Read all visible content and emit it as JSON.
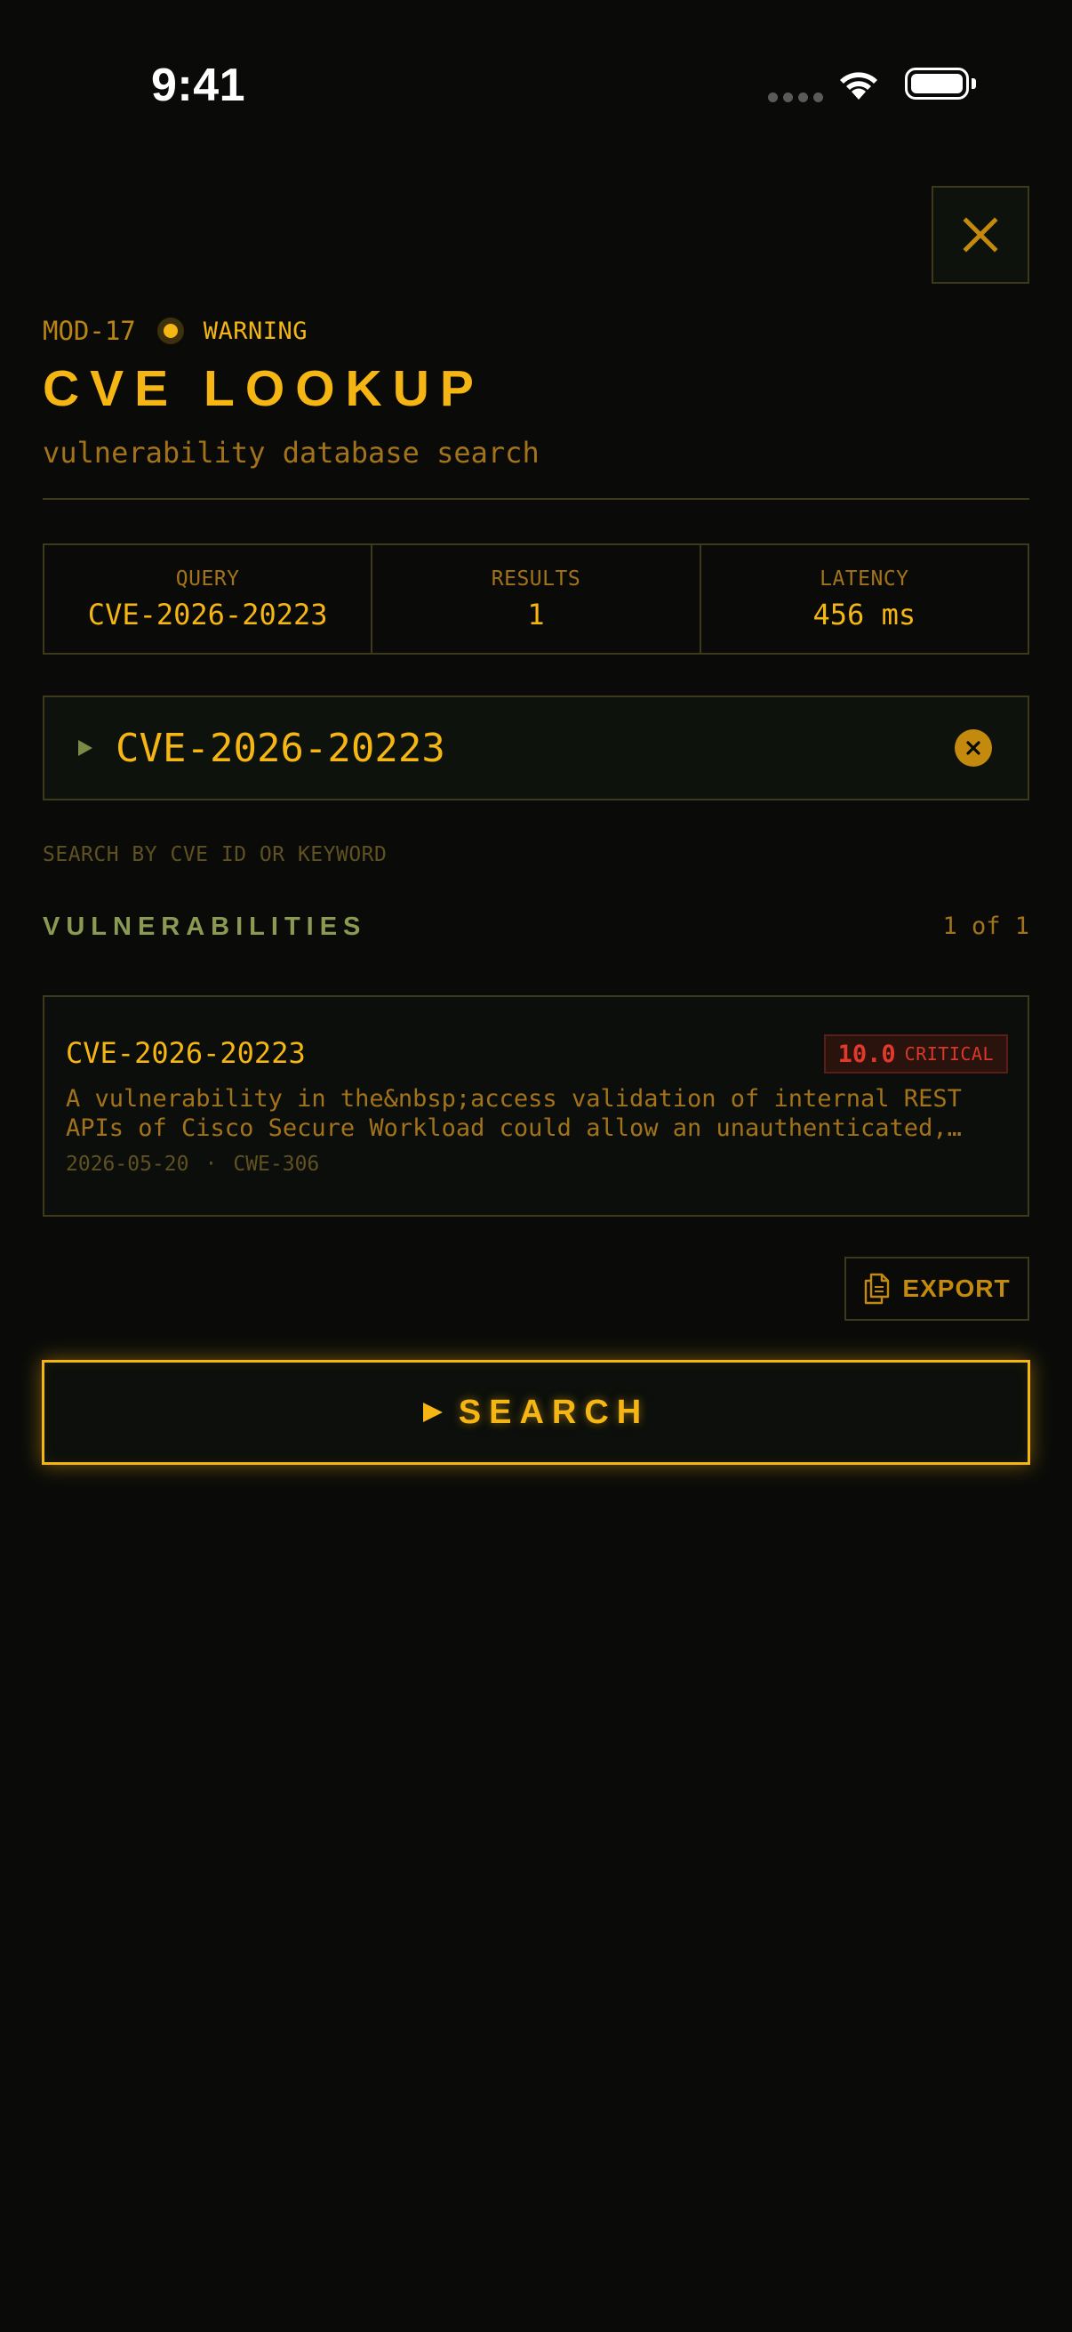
{
  "status_bar": {
    "time": "9:41"
  },
  "header": {
    "module_id": "MOD-17",
    "status": "WARNING",
    "title": "CVE LOOKUP",
    "subtitle": "vulnerability database search"
  },
  "stats": [
    {
      "label": "QUERY",
      "value": "CVE-2026-20223"
    },
    {
      "label": "RESULTS",
      "value": "1"
    },
    {
      "label": "LATENCY",
      "value": "456 ms"
    }
  ],
  "search": {
    "value": "CVE-2026-20223",
    "hint": "SEARCH BY CVE ID OR KEYWORD"
  },
  "results": {
    "section_title": "VULNERABILITIES",
    "pager": "1 of 1",
    "items": [
      {
        "id": "CVE-2026-20223",
        "score": "10.0",
        "severity": "CRITICAL",
        "description_line1": "A vulnerability in the&nbsp;access validation of internal REST",
        "description_line2": "APIs of Cisco Secure Workload could allow an unauthenticated,…",
        "date": "2026-05-20",
        "meta_separator": "·",
        "cwe": "CWE-306"
      }
    ]
  },
  "actions": {
    "export_label": "EXPORT",
    "search_label": "SEARCH"
  },
  "colors": {
    "background": "#0a0b09",
    "accent": "#f5b512",
    "muted": "#a2731a",
    "border": "#3d3a1c",
    "section": "#8a9a52",
    "critical": "#e2392a"
  },
  "icons": {
    "close": "close-icon",
    "prompt": "prompt-arrow-icon",
    "clear": "clear-circle-icon",
    "export": "document-copy-icon",
    "search": "play-arrow-icon"
  }
}
